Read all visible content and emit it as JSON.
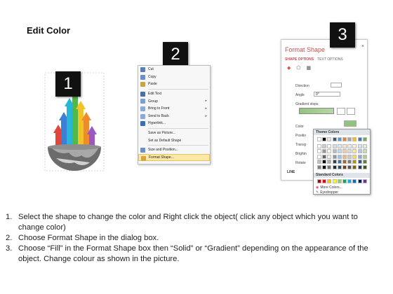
{
  "title": "Edit Color",
  "badges": {
    "one": "1",
    "two": "2",
    "three": "3"
  },
  "context_menu": {
    "items": [
      {
        "label": "Cut",
        "icon": "scissors-icon",
        "color": "#5b7fb5",
        "arrow": false
      },
      {
        "label": "Copy",
        "icon": "copy-icon",
        "color": "#6d8fc9",
        "arrow": false
      },
      {
        "label": "Paste",
        "icon": "paste-icon",
        "color": "#c9a24a",
        "arrow": false
      },
      {
        "label": "Edit Text",
        "icon": "edit-text-icon",
        "color": "#4a6fa5",
        "arrow": false
      },
      {
        "label": "Group",
        "icon": "group-icon",
        "color": "#7f9fd0",
        "arrow": true
      },
      {
        "label": "Bring to Front",
        "icon": "bring-front-icon",
        "color": "#8aa8d8",
        "arrow": true
      },
      {
        "label": "Send to Back",
        "icon": "send-back-icon",
        "color": "#8aa8d8",
        "arrow": true
      },
      {
        "label": "Hyperlink...",
        "icon": "hyperlink-icon",
        "color": "#3d6cb3",
        "arrow": false
      },
      {
        "label": "Save as Picture...",
        "icon": "",
        "color": "",
        "arrow": false
      },
      {
        "label": "Set as Default Shape",
        "icon": "",
        "color": "",
        "arrow": false
      },
      {
        "label": "Size and Position...",
        "icon": "size-position-icon",
        "color": "#6f8fbf",
        "arrow": false
      },
      {
        "label": "Format Shape...",
        "icon": "format-shape-icon",
        "color": "#d9a53a",
        "arrow": false
      }
    ]
  },
  "format_pane": {
    "title": "Format Shape",
    "close": "×",
    "tabs": [
      "SHAPE OPTIONS",
      "TEXT OPTIONS"
    ],
    "direction_label": "Direction",
    "angle_label": "Angle",
    "angle_value": "0°",
    "gradient_stops_label": "Gradient stops",
    "color_label": "Color",
    "position_label": "Positio",
    "transparency_label": "Transp",
    "brightness_label": "Brightn",
    "rotate_label": "Rotate",
    "line_label": "LINE"
  },
  "palette": {
    "theme_header": "Theme Colors",
    "standard_header": "Standard Colors",
    "more_colors": "More Colors...",
    "eyedropper": "Eyedropper",
    "theme_columns": [
      "#ffffff",
      "#000000",
      "#e7e6e6",
      "#44546a",
      "#5b9bd5",
      "#ed7d31",
      "#a5a5a5",
      "#ffc000",
      "#4472c4",
      "#70ad47"
    ],
    "standard": [
      "#c00000",
      "#ff0000",
      "#ffc000",
      "#ffff00",
      "#92d050",
      "#00b050",
      "#00b0f0",
      "#0070c0",
      "#002060",
      "#7030a0"
    ]
  },
  "steps": [
    {
      "num": "1.",
      "text": "Select the shape to change the color and Right click the object( click any object which you want to change color)"
    },
    {
      "num": "2.",
      "text": "Choose Format Shape in the dialog box."
    },
    {
      "num": "3.",
      "text": "Choose “Fill” in the Format Shape box then “Solid” or “Gradient” depending on the appearance of the object. Change colour as shown in the picture."
    }
  ]
}
